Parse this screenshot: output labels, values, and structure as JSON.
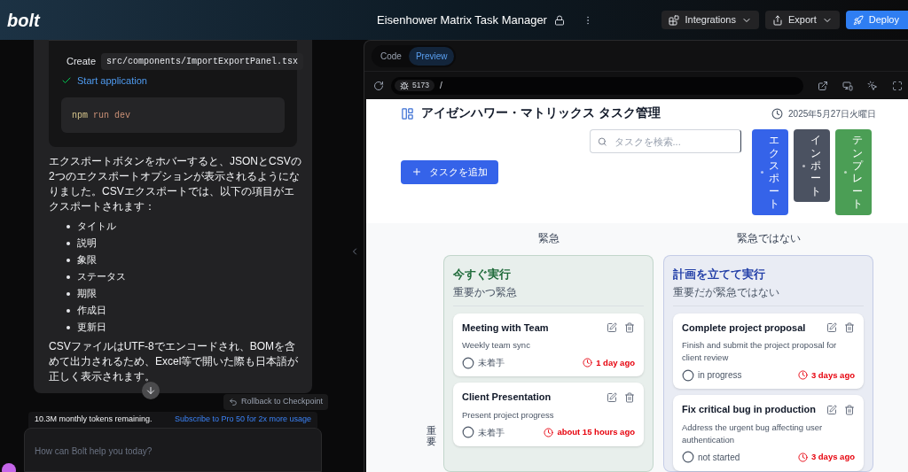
{
  "header": {
    "logo": "bolt",
    "project_title": "Eisenhower Matrix Task Manager",
    "buttons": [
      {
        "label": "Integrations",
        "kind": "integrations"
      },
      {
        "label": "Export",
        "kind": "export"
      },
      {
        "label": "Deploy",
        "kind": "deploy"
      }
    ]
  },
  "chat": {
    "steps": [
      {
        "text": "Create",
        "code": "src/components/ImportExportPanel.tsx",
        "kind": "file"
      },
      {
        "text": "Start application",
        "kind": "command"
      }
    ],
    "command": [
      "npm",
      "run",
      "dev"
    ],
    "paragraph": "エクスポートボタンをホバーすると、JSONとCSVの2つのエクスポートオプションが表示されるようになりました。CSVエクスポートでは、以下の項目がエクスポートされます：",
    "list": [
      "タイトル",
      "説明",
      "象限",
      "ステータス",
      "期限",
      "作成日",
      "更新日"
    ],
    "paragraph_2": "CSVファイルはUTF-8でエンコードされ、BOMを含めて出力されるため、Excel等で開いた際も日本語が正しく表示されます。",
    "rollback": "Rollback to Checkpoint",
    "tokens": "10.3M monthly tokens remaining.",
    "subscribe": "Subscribe to Pro 50 for 2x more usage",
    "input_placeholder": "How can Bolt help you today?"
  },
  "preview": {
    "tabs": [
      {
        "label": "Code",
        "selected": false
      },
      {
        "label": "Preview",
        "selected": true
      }
    ],
    "port": "5173",
    "path": "/",
    "app": {
      "title": "アイゼンハワー・マトリックス タスク管理",
      "date": "2025年5月27日火曜日",
      "search_placeholder": "タスクを検索...",
      "add_button": "タスクを追加",
      "side_buttons": [
        {
          "label": "エクスポート",
          "color": "#3563e9"
        },
        {
          "label": "インポート",
          "color": "#4b5261"
        },
        {
          "label": "テンプレート",
          "color": "#4b9e55"
        }
      ],
      "columns": [
        "緊急",
        "緊急ではない"
      ],
      "row_label": "重要",
      "quadrants": [
        {
          "title": "今すぐ実行",
          "subtitle": "重要かつ緊急",
          "color": "#1f6b3a",
          "tasks": [
            {
              "title": "Meeting with Team",
              "description": "Weekly team sync",
              "status": "未着手",
              "due": "1 day ago"
            },
            {
              "title": "Client Presentation",
              "description": "Present project progress",
              "status": "未着手",
              "due": "about 15 hours ago"
            }
          ]
        },
        {
          "title": "計画を立てて実行",
          "subtitle": "重要だが緊急ではない",
          "color": "#2440a8",
          "tasks": [
            {
              "title": "Complete project proposal",
              "description": "Finish and submit the project proposal for client review",
              "status": "in progress",
              "due": "3 days ago"
            },
            {
              "title": "Fix critical bug in production",
              "description": "Address the urgent bug affecting user authentication",
              "status": "not started",
              "due": "3 days ago"
            }
          ]
        }
      ]
    }
  }
}
